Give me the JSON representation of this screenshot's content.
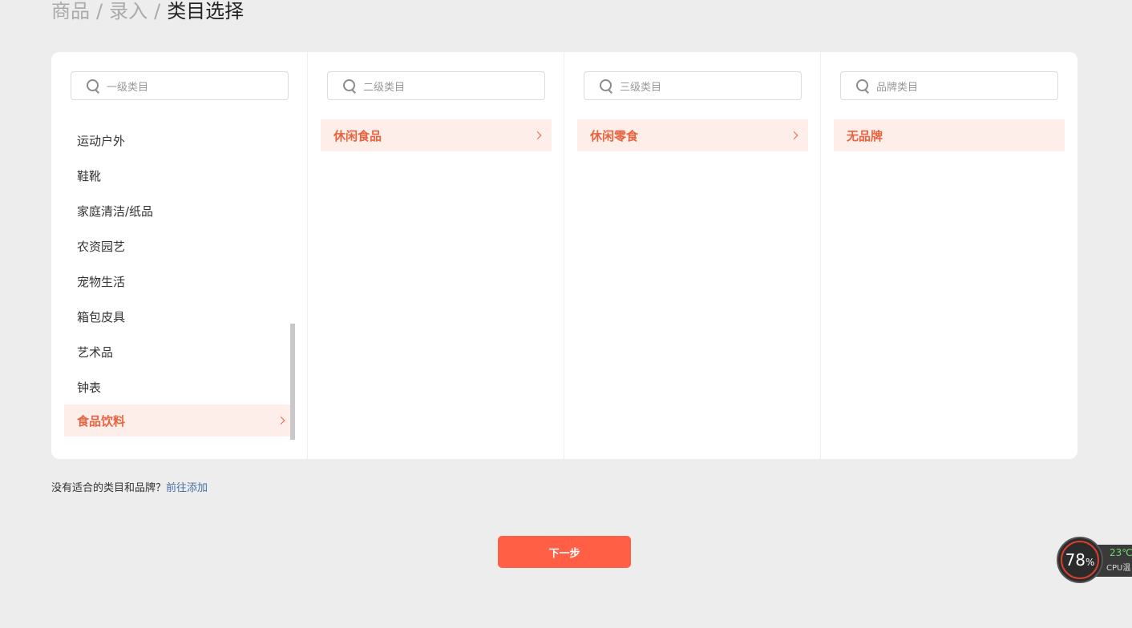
{
  "breadcrumb": {
    "items": [
      "商品",
      "录入"
    ],
    "separator": "/",
    "current": "类目选择"
  },
  "columns": {
    "level1": {
      "placeholder": "一级类目",
      "items": [
        "运动户外",
        "鞋靴",
        "家庭清洁/纸品",
        "农资园艺",
        "宠物生活",
        "箱包皮具",
        "艺术品",
        "钟表"
      ],
      "selected": "食品饮料"
    },
    "level2": {
      "placeholder": "二级类目",
      "selected": "休闲食品"
    },
    "level3": {
      "placeholder": "三级类目",
      "selected": "休闲零食"
    },
    "brand": {
      "placeholder": "品牌类目",
      "selected": "无品牌"
    }
  },
  "hint": {
    "text": "没有适合的类目和品牌？",
    "link": "前往添加"
  },
  "next_button": "下一步",
  "cpu_widget": {
    "percent": "78",
    "percent_unit": "%",
    "temp": "23℃",
    "label": "CPU温"
  },
  "colors": {
    "accent": "#ff5f45",
    "selected_bg": "#fdeeea",
    "selected_text": "#e8643f",
    "link": "#4a6fa5",
    "page_bg": "#ededed"
  }
}
